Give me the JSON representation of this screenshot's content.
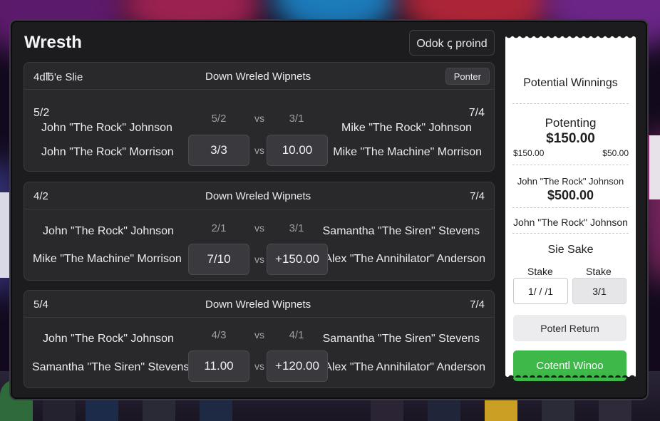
{
  "app": {
    "title": "Wresth",
    "top_button_label": "Odok ꞔ proind"
  },
  "colors": {
    "window_bg": "#1c1c1f",
    "card_bg": "#29292c",
    "accent_green": "#3fb84a",
    "slip_bg": "#ffffff"
  },
  "matches": [
    {
      "left_odds": "5/2",
      "header_mid": "Down Wreled Wipnets",
      "right_odds": "7/4",
      "header_left": "4d℔'e Slie",
      "header_button": "Ponter",
      "left_top": "John \"The Rock\" Johnson",
      "left_bottom": "John \"The Rock\" Morrison",
      "right_top": "Mike \"The Rock\" Johnson",
      "right_bottom": "Mike \"The Machine\" Morrison",
      "odd_label_left": "5/2",
      "odd_label_right": "3/1",
      "vs_top": "vs",
      "vs_bottom": "vs",
      "box_left": "3/3",
      "box_right": "10.00"
    },
    {
      "header_left": "4/2",
      "header_mid": "Down Wreled Wipnets",
      "header_right": "7/4",
      "left_top": "John \"The Rock\" Johnson",
      "left_bottom": "Mike \"The Machine\" Morrison",
      "right_top": "Samantha \"The Siren\" Stevens",
      "right_bottom": "Alex \"The Annihilator\" Anderson",
      "odd_label_left": "2/1",
      "odd_label_right": "3/1",
      "vs_top": "vs",
      "vs_bottom": "vs",
      "box_left": "7/10",
      "box_right": "+150.00"
    },
    {
      "header_left": "5/4",
      "header_mid": "Down Wreled Wipnets",
      "header_right": "7/4",
      "left_top": "John \"The Rock\" Johnson",
      "left_bottom": "Samantha \"The Siren\" Stevens",
      "right_top": "Samantha \"The Siren\" Stevens",
      "right_bottom": "Alex \"The Annihilator\" Anderson",
      "odd_label_left": "4/3",
      "odd_label_right": "4/1",
      "vs_top": "vs",
      "vs_bottom": "vs",
      "box_left": "11.00",
      "box_right": "+120.00"
    }
  ],
  "bet_slip": {
    "title": "Potential Winnings",
    "potenting_label": "Potenting",
    "potenting_amount": "$150.00",
    "small_left": "$150.00",
    "small_right": "$50.00",
    "selection_name": "John \"The Rock\" Johnson",
    "selection_amount": "$500.00",
    "second_name": "John \"The Rock\" Johnson",
    "sake_label": "Sie Sake",
    "stake_label_left": "Stake",
    "stake_label_right": "Stake",
    "stake_input_value": "1/ / /1",
    "stake_odds": "3/1",
    "return_button": "Poterl Return",
    "win_button": "Cotentl Winoo"
  }
}
